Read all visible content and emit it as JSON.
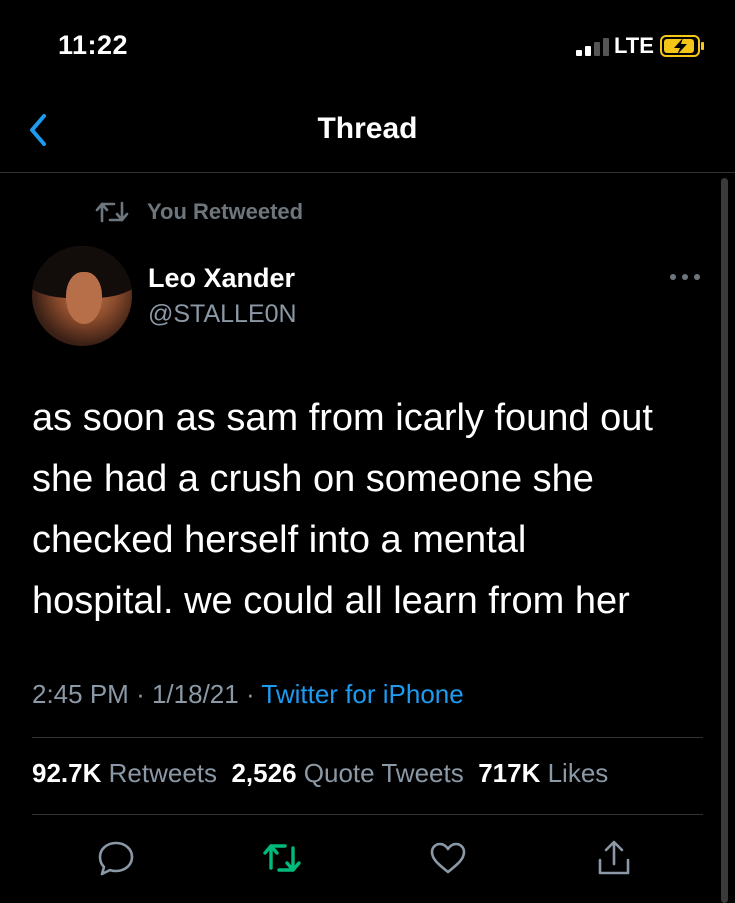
{
  "status": {
    "time": "11:22",
    "network": "LTE",
    "battery_color": "#f5c518"
  },
  "nav": {
    "title": "Thread",
    "back_icon": "chevron-left-icon"
  },
  "tweet": {
    "retweet_notice": "You Retweeted",
    "author_name": "Leo Xander",
    "author_handle": "@STALLE0N",
    "lines": [
      "as soon as sam from icarly found out",
      "she had a crush on someone she",
      "checked herself into a mental",
      "hospital. we could all learn from her"
    ],
    "time": "2:45 PM",
    "date": "1/18/21",
    "separator": "·",
    "source": "Twitter for iPhone",
    "stats": {
      "retweets_count": "92.7K",
      "retweets_label": "Retweets",
      "quotes_count": "2,526",
      "quotes_label": "Quote Tweets",
      "likes_count": "717K",
      "likes_label": "Likes"
    }
  },
  "colors": {
    "accent": "#1d9bf0",
    "retweet_active": "#00ba7c",
    "muted": "#8b98a5"
  }
}
